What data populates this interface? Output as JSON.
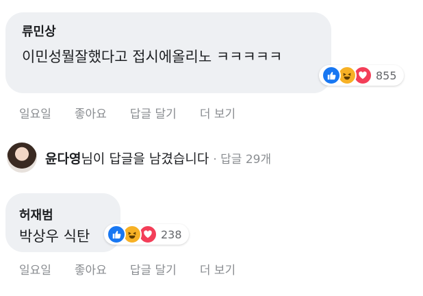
{
  "comments": [
    {
      "author": "류민상",
      "text": "이민성뭘잘했다고 접시에올리노 ㅋㅋㅋㅋㅋ",
      "reaction_count": "855",
      "actions": {
        "time": "일요일",
        "like": "좋아요",
        "reply": "답글 달기",
        "more": "더 보기"
      }
    },
    {
      "author": "허재범",
      "text": "박상우 식탄",
      "reaction_count": "238",
      "actions": {
        "time": "일요일",
        "like": "좋아요",
        "reply": "답글 달기",
        "more": "더 보기"
      }
    }
  ],
  "reply_summary": {
    "name": "윤다영",
    "text": "님이 답글을 남겼습니다",
    "meta": "· 답글 29개"
  },
  "icons": {
    "like": "like-icon",
    "haha": "haha-icon",
    "love": "love-icon"
  },
  "colors": {
    "like": "#1877f2",
    "haha": "#f7b125",
    "love": "#f33e58",
    "bubble": "#eef0f3"
  }
}
